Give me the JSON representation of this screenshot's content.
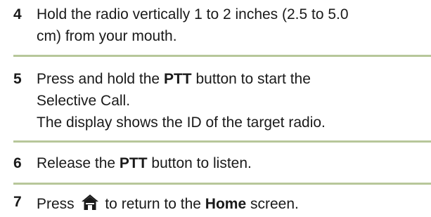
{
  "steps": [
    {
      "number": "4",
      "line1": "Hold the radio vertically 1 to 2 inches (2.5 to 5.0",
      "line2": "cm) from your mouth."
    },
    {
      "number": "5",
      "l1_pre": "Press and hold the ",
      "l1_bold": "PTT",
      "l1_post": " button to start the",
      "line2": "Selective Call.",
      "line3": "The display shows the ID of the target radio."
    },
    {
      "number": "6",
      "pre": "Release the ",
      "bold": "PTT",
      "post": " button to listen."
    },
    {
      "number": "7",
      "pre": "Press ",
      "icon": "home-icon",
      "mid": " to return to the ",
      "bold": "Home",
      "post": " screen."
    }
  ],
  "colors": {
    "divider": "#b7c79a",
    "text": "#1a1a1a"
  }
}
